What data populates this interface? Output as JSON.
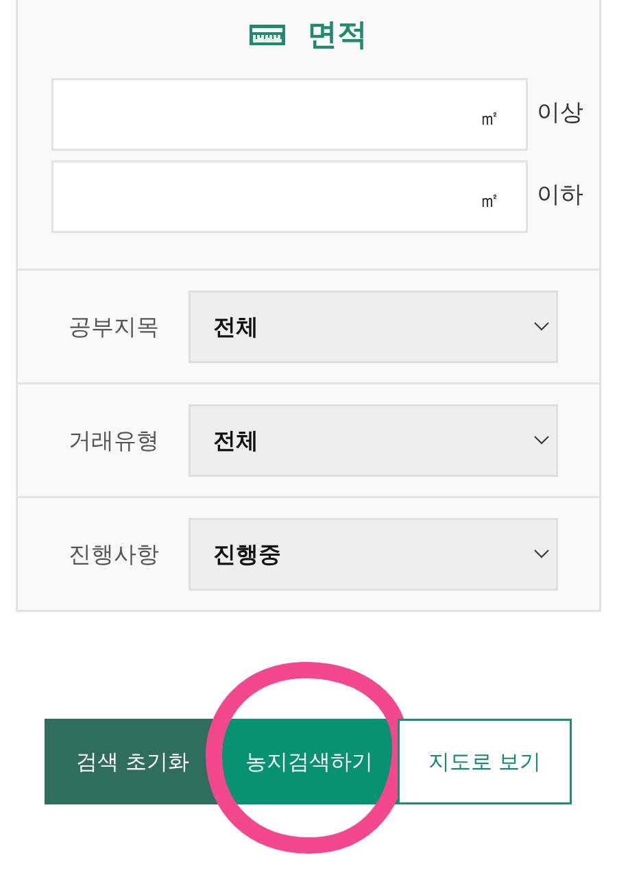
{
  "area_filter": {
    "title": "면적",
    "fields": [
      {
        "unit": "㎡",
        "suffix": "이상"
      },
      {
        "unit": "㎡",
        "suffix": "이하"
      }
    ]
  },
  "selects": [
    {
      "label": "공부지목",
      "value": "전체"
    },
    {
      "label": "거래유형",
      "value": "전체"
    },
    {
      "label": "진행사항",
      "value": "진행중"
    }
  ],
  "buttons": [
    {
      "label": "검색 초기화",
      "kind": "secondary",
      "highlighted": false
    },
    {
      "label": "농지검색하기",
      "kind": "primary",
      "highlighted": true
    },
    {
      "label": "지도로 보기",
      "kind": "outline",
      "highlighted": false
    }
  ]
}
